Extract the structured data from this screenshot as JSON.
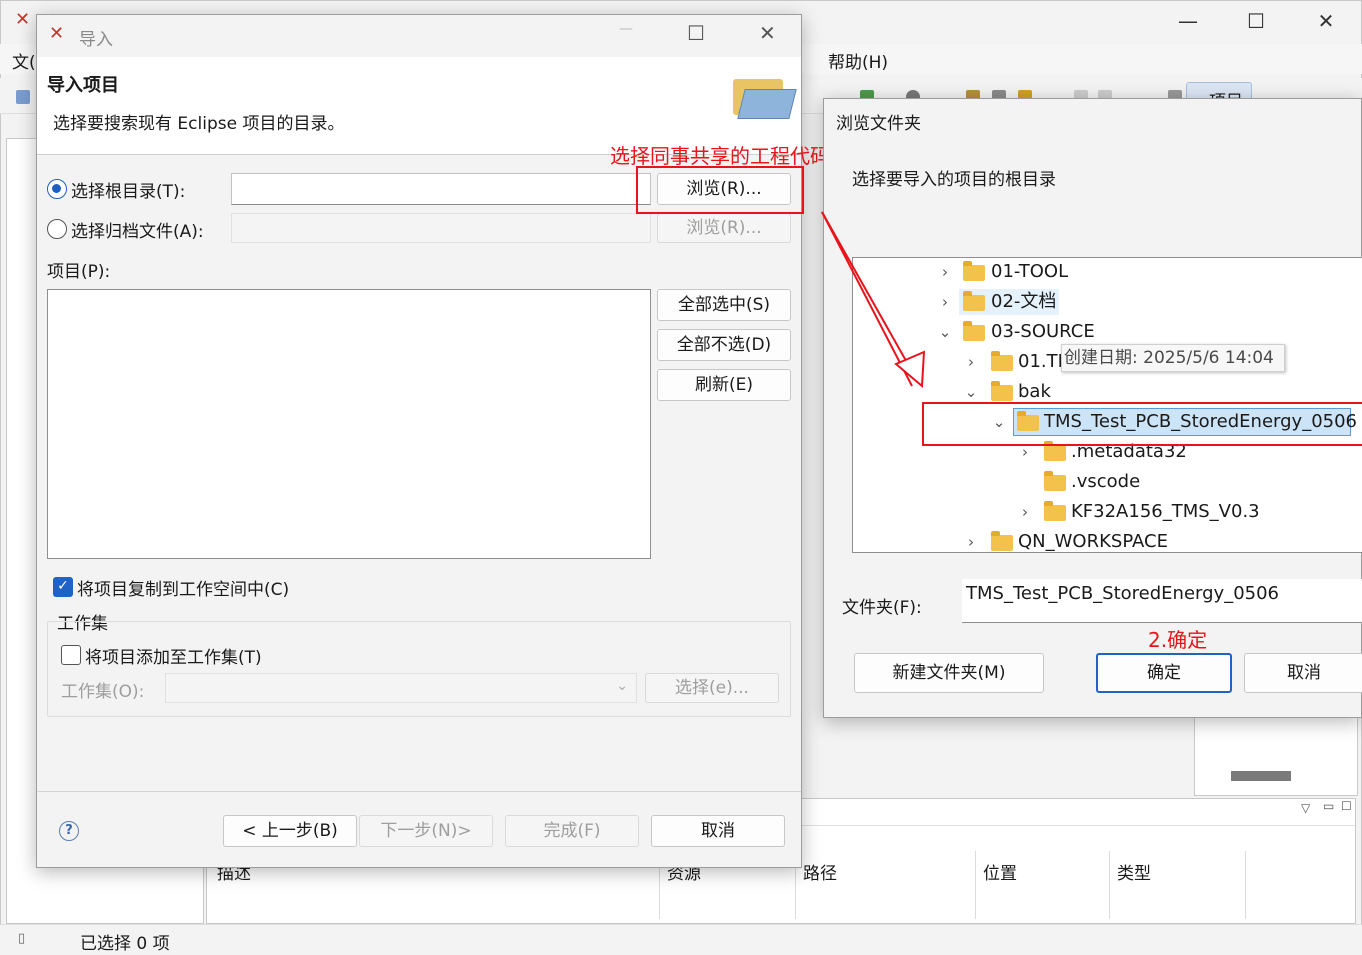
{
  "main_window": {
    "menu_file_partial": "文(",
    "menu_help": "帮助(H)",
    "perspective_label": "项目",
    "bottom_columns": [
      "描述",
      "资源",
      "路径",
      "位置",
      "类型"
    ],
    "status_text": "已选择 0 项"
  },
  "import_dialog": {
    "title": "导入",
    "header_title": "导入项目",
    "header_desc": "选择要搜索现有 Eclipse 项目的目录。",
    "radio_root_label": "选择根目录(T):",
    "radio_archive_label": "选择归档文件(A):",
    "browse_label": "浏览(R)...",
    "browse_disabled_label": "浏览(R)...",
    "projects_label": "项目(P):",
    "select_all_label": "全部选中(S)",
    "deselect_all_label": "全部不选(D)",
    "refresh_label": "刷新(E)",
    "copy_checkbox_label": "将项目复制到工作空间中(C)",
    "working_set_group": "工作集",
    "add_to_working_set_label": "将项目添加至工作集(T)",
    "working_set_field_label": "工作集(O):",
    "working_set_select_label": "选择(e)...",
    "back_label": "< 上一步(B)",
    "next_label": "下一步(N)>",
    "finish_label": "完成(F)",
    "cancel_label": "取消",
    "help_icon_glyph": "?"
  },
  "annotations": {
    "annotation1": "选择同事共享的工程代码路径",
    "annotation2": "2.确定"
  },
  "browse_dialog": {
    "title": "浏览文件夹",
    "desc": "选择要导入的项目的根目录",
    "tree": [
      {
        "label": "01-TOOL",
        "chevron": "›"
      },
      {
        "label": "02-文档",
        "chevron": "›"
      },
      {
        "label": "03-SOURCE",
        "chevron": "⌄"
      },
      {
        "label": "01.TI",
        "chevron": "›"
      },
      {
        "label": "bak",
        "chevron": "⌄"
      },
      {
        "label": "TMS_Test_PCB_StoredEnergy_0506",
        "chevron": "⌄"
      },
      {
        "label": ".metadata32",
        "chevron": "›"
      },
      {
        "label": ".vscode",
        "chevron": ""
      },
      {
        "label": "KF32A156_TMS_V0.3",
        "chevron": "›"
      },
      {
        "label": "QN_WORKSPACE",
        "chevron": "›"
      }
    ],
    "tooltip": "创建日期: 2025/5/6 14:04",
    "folder_label": "文件夹(F):",
    "folder_value": "TMS_Test_PCB_StoredEnergy_0506",
    "new_folder_label": "新建文件夹(M)",
    "ok_label": "确定",
    "cancel_label": "取消"
  },
  "colors": {
    "annotation_red": "#e8141b",
    "accent_blue": "#1f63c6",
    "selection_blue": "#cce4f7"
  }
}
